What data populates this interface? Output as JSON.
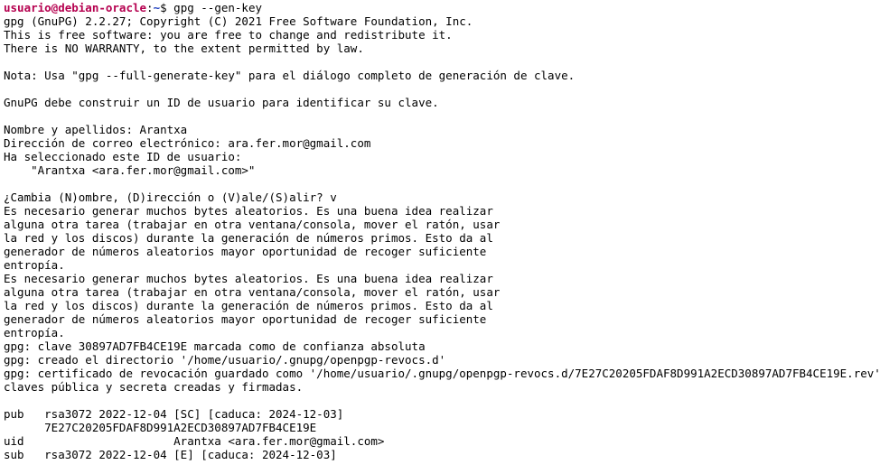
{
  "prompt": {
    "user_host": "usuario@debian-oracle",
    "separator": ":",
    "path": "~",
    "symbol": "$ ",
    "command": "gpg --gen-key"
  },
  "colors": {
    "background": "#ffffff",
    "text": "#000000",
    "user_host": "#b5004f",
    "path": "#1f3fbf"
  },
  "output_lines": [
    "gpg (GnuPG) 2.2.27; Copyright (C) 2021 Free Software Foundation, Inc.",
    "This is free software: you are free to change and redistribute it.",
    "There is NO WARRANTY, to the extent permitted by law.",
    "",
    "Nota: Usa \"gpg --full-generate-key\" para el diálogo completo de generación de clave.",
    "",
    "GnuPG debe construir un ID de usuario para identificar su clave.",
    "",
    "Nombre y apellidos: Arantxa",
    "Dirección de correo electrónico: ara.fer.mor@gmail.com",
    "Ha seleccionado este ID de usuario:",
    "    \"Arantxa <ara.fer.mor@gmail.com>\"",
    "",
    "¿Cambia (N)ombre, (D)irección o (V)ale/(S)alir? v",
    "Es necesario generar muchos bytes aleatorios. Es una buena idea realizar",
    "alguna otra tarea (trabajar en otra ventana/consola, mover el ratón, usar",
    "la red y los discos) durante la generación de números primos. Esto da al",
    "generador de números aleatorios mayor oportunidad de recoger suficiente",
    "entropía.",
    "Es necesario generar muchos bytes aleatorios. Es una buena idea realizar",
    "alguna otra tarea (trabajar en otra ventana/consola, mover el ratón, usar",
    "la red y los discos) durante la generación de números primos. Esto da al",
    "generador de números aleatorios mayor oportunidad de recoger suficiente",
    "entropía.",
    "gpg: clave 30897AD7FB4CE19E marcada como de confianza absoluta",
    "gpg: creado el directorio '/home/usuario/.gnupg/openpgp-revocs.d'",
    "gpg: certificado de revocación guardado como '/home/usuario/.gnupg/openpgp-revocs.d/7E27C20205FDAF8D991A2ECD30897AD7FB4CE19E.rev'",
    "claves pública y secreta creadas y firmadas.",
    "",
    "pub   rsa3072 2022-12-04 [SC] [caduca: 2024-12-03]",
    "      7E27C20205FDAF8D991A2ECD30897AD7FB4CE19E",
    "uid                      Arantxa <ara.fer.mor@gmail.com>",
    "sub   rsa3072 2022-12-04 [E] [caduca: 2024-12-03]"
  ]
}
